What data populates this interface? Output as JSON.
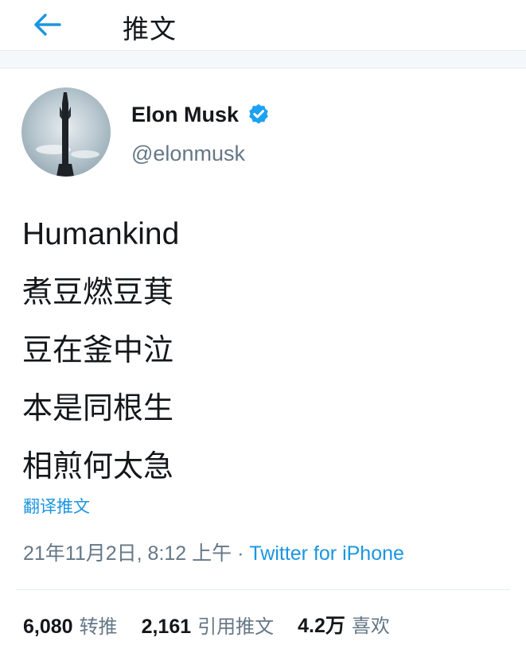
{
  "header": {
    "title": "推文"
  },
  "author": {
    "name": "Elon Musk",
    "handle": "@elonmusk",
    "verified": true
  },
  "tweet": {
    "lines": [
      "Humankind",
      "煮豆燃豆萁",
      "豆在釜中泣",
      "本是同根生",
      "相煎何太急"
    ],
    "translate_label": "翻译推文"
  },
  "meta": {
    "timestamp": "21年11月2日, 8:12 上午",
    "separator": " · ",
    "source": "Twitter for iPhone"
  },
  "stats": {
    "retweets": {
      "count": "6,080",
      "label": "转推"
    },
    "quotes": {
      "count": "2,161",
      "label": "引用推文"
    },
    "likes": {
      "count": "4.2万",
      "label": "喜欢"
    }
  },
  "colors": {
    "accent": "#1b95e0",
    "text": "#14171a",
    "secondary": "#657786"
  }
}
